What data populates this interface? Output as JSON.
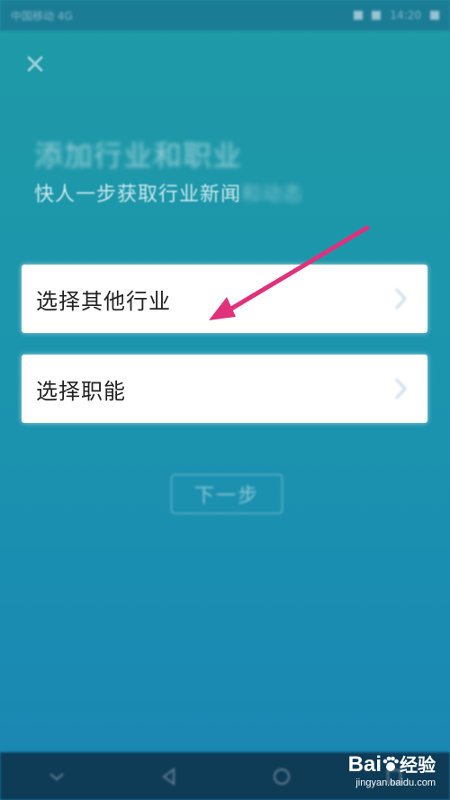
{
  "status_bar": {
    "left_text": "中国移动 4G",
    "right_text": "14:20"
  },
  "header": {
    "title": "添加行业和职业",
    "subtitle_main": "快人一步获取行业新闻",
    "subtitle_faded": "和动态"
  },
  "options": [
    {
      "label": "选择其他行业",
      "icon": "chevron-right-icon"
    },
    {
      "label": "选择职能",
      "icon": "chevron-right-icon"
    }
  ],
  "next_button": {
    "label": "下一步"
  },
  "annotation": {
    "arrow_color": "#e0317b"
  },
  "nav_bar": {
    "icons": [
      "menu-icon",
      "back-icon",
      "home-icon",
      "recents-icon"
    ]
  },
  "watermark": {
    "logo_text": "Bai",
    "logo_suffix": "经验",
    "url": "jingyan.baidu.com"
  },
  "colors": {
    "background_top": "#1f9aa6",
    "background_bottom": "#1a86b4",
    "card": "#ffffff",
    "nav_bar": "#0e3b56"
  }
}
